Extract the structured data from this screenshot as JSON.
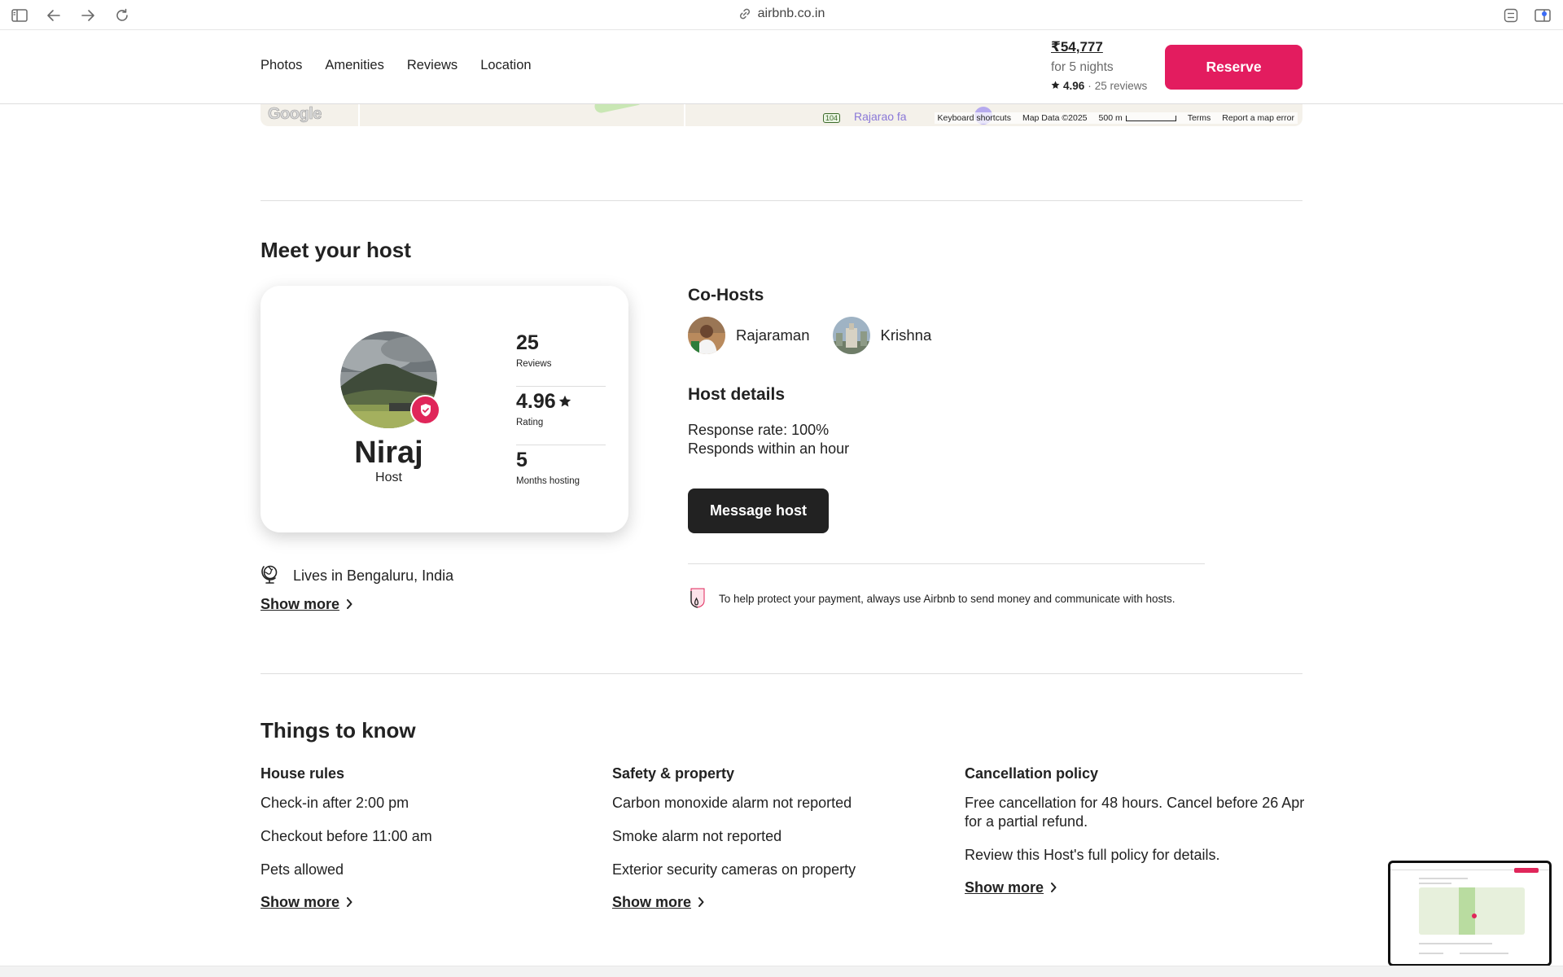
{
  "browser": {
    "url": "airbnb.co.in"
  },
  "header": {
    "tabs": [
      "Photos",
      "Amenities",
      "Reviews",
      "Location"
    ],
    "price": "₹54,777",
    "nights": "for 5 nights",
    "rating": "4.96",
    "reviews": "25 reviews",
    "separator": "·",
    "reserve_label": "Reserve",
    "accent_color": "#e31c5f"
  },
  "map": {
    "google_logo": "Google",
    "road_badge": "104",
    "place_label": "Rajarao fa",
    "shortcuts": "Keyboard shortcuts",
    "map_data": "Map Data ©2025",
    "scale": "500 m",
    "terms": "Terms",
    "report": "Report a map error"
  },
  "host_section": {
    "title": "Meet your host",
    "host_name": "Niraj",
    "host_role": "Host",
    "stats": [
      {
        "value": "25",
        "label": "Reviews"
      },
      {
        "value": "4.96",
        "label": "Rating"
      },
      {
        "value": "5",
        "label": "Months hosting"
      }
    ],
    "lives_in": "Lives in Bengaluru, India",
    "show_more": "Show more",
    "cohosts_title": "Co-Hosts",
    "cohosts": [
      "Rajaraman",
      "Krishna"
    ],
    "host_details_title": "Host details",
    "response_rate": "Response rate: 100%",
    "response_time": "Responds within an hour",
    "message_label": "Message host",
    "protect_text": "To help protect your payment, always use Airbnb to send money and communicate with hosts."
  },
  "things_to_know": {
    "title": "Things to know",
    "columns": [
      {
        "heading": "House rules",
        "items": [
          "Check-in after 2:00 pm",
          "Checkout before 11:00 am",
          "Pets allowed"
        ],
        "show_more": "Show more"
      },
      {
        "heading": "Safety & property",
        "items": [
          "Carbon monoxide alarm not reported",
          "Smoke alarm not reported",
          "Exterior security cameras on property"
        ],
        "show_more": "Show more"
      },
      {
        "heading": "Cancellation policy",
        "items": [
          "Free cancellation for 48 hours. Cancel before 26 Apr for a partial refund.",
          "Review this Host's full policy for details."
        ],
        "show_more": "Show more"
      }
    ]
  }
}
